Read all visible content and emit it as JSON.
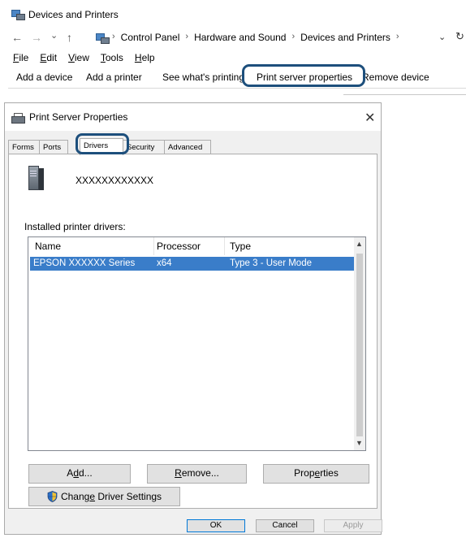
{
  "explorer": {
    "title": "Devices and Printers",
    "nav": {
      "back": "←",
      "forward": "→",
      "recent": "⌄",
      "up": "↑"
    },
    "breadcrumbs": [
      "Control Panel",
      "Hardware and Sound",
      "Devices and Printers"
    ],
    "breadcrumb_sep": "›",
    "menu": [
      {
        "acc": "F",
        "rest": "ile"
      },
      {
        "acc": "E",
        "rest": "dit"
      },
      {
        "acc": "V",
        "rest": "iew"
      },
      {
        "acc": "T",
        "rest": "ools"
      },
      {
        "acc": "H",
        "rest": "elp"
      }
    ],
    "commands": {
      "add_device": "Add a device",
      "add_printer": "Add a printer",
      "see_printing": "See what's printing",
      "print_server": "Print server properties",
      "remove_device": "Remove device"
    },
    "highlight_color": "#1d4f7c"
  },
  "dialog": {
    "title": "Print Server Properties",
    "close": "✕",
    "tabs": [
      "Forms",
      "Ports",
      "Drivers",
      "Security",
      "Advanced"
    ],
    "active_tab": "Drivers",
    "server_name": "XXXXXXXXXXXX",
    "drivers_label": "Installed printer drivers:",
    "columns": [
      "Name",
      "Processor",
      "Type"
    ],
    "rows": [
      {
        "name": "EPSON XXXXXX Series",
        "processor": "x64",
        "type": "Type 3 - User Mode",
        "selected": true
      }
    ],
    "buttons": {
      "add_pre": "A",
      "add_acc": "d",
      "add_post": "d...",
      "remove_acc": "R",
      "remove_post": "emove...",
      "props_pre": "Prop",
      "props_acc": "e",
      "props_post": "rties",
      "change_pre": "Chang",
      "change_acc": "e",
      "change_post": " Driver Settings",
      "ok": "OK",
      "cancel": "Cancel",
      "apply": "Apply"
    },
    "selection_color": "#3a7dc9"
  }
}
